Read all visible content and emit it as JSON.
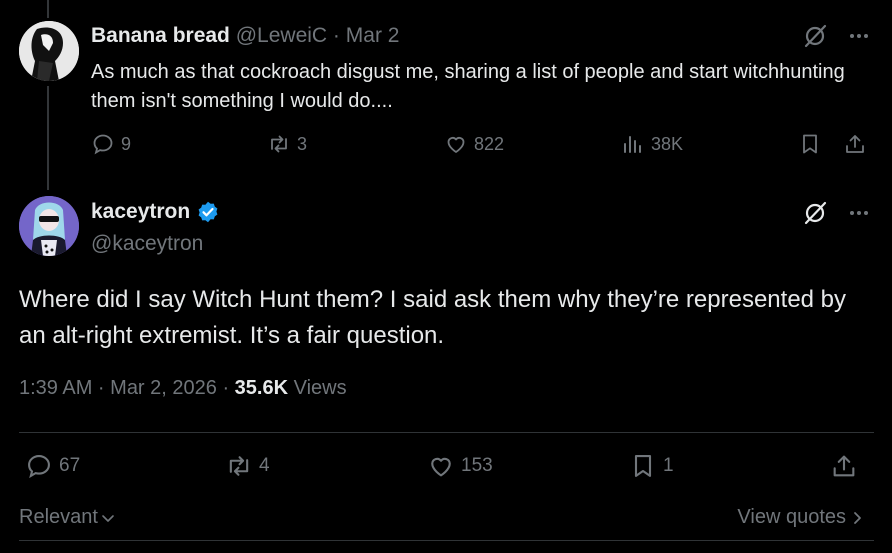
{
  "reply": {
    "name": "Banana bread",
    "handle": "@LeweiC",
    "separator": " · ",
    "date": "Mar 2",
    "text": "As much as that cockroach disgust me, sharing a list of people and start witchhunting them isn't something I would do....",
    "replies": "9",
    "reposts": "3",
    "likes": "822",
    "views": "38K"
  },
  "post": {
    "name": "kaceytron",
    "handle": "@kaceytron",
    "verified": true,
    "text": "Where did I say Witch Hunt them? I said ask them why they’re represented by an alt-right extremist. It’s a fair question.",
    "time": "1:39 AM · Mar 2, 2026 · ",
    "views_count": "35.6K",
    "views_label": " Views",
    "replies": "67",
    "reposts": "4",
    "likes": "153",
    "bookmarks": "1"
  },
  "footer": {
    "sort_label": "Relevant",
    "view_quotes": "View quotes"
  },
  "colors": {
    "background": "#000000",
    "text": "#e7e9ea",
    "muted": "#71767b",
    "verified": "#1d9bf0"
  },
  "icons": [
    "reply-icon",
    "repost-icon",
    "like-icon",
    "views-icon",
    "bookmark-icon",
    "share-icon",
    "grok-icon",
    "more-icon",
    "verified-icon",
    "chevron-down-icon",
    "chevron-right-icon"
  ]
}
